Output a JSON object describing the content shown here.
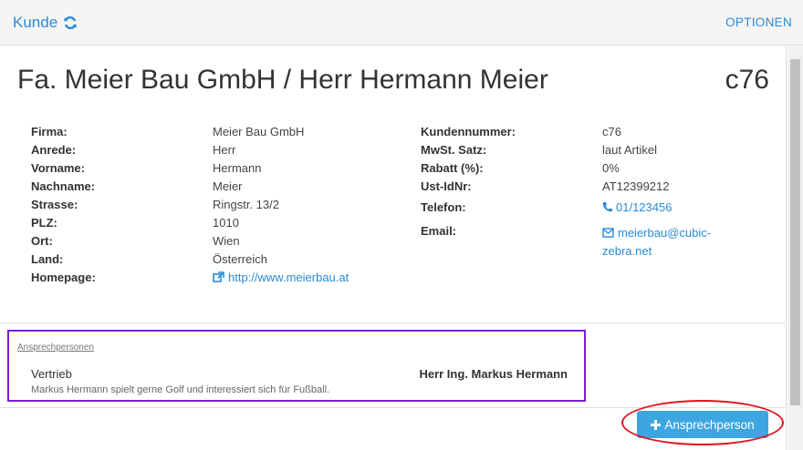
{
  "header": {
    "title": "Kunde",
    "options_label": "OPTIONEN"
  },
  "customer": {
    "display_name": "Fa. Meier Bau GmbH / Herr Hermann Meier",
    "code": "c76"
  },
  "left_fields": [
    {
      "label": "Firma:",
      "value": "Meier Bau GmbH"
    },
    {
      "label": "Anrede:",
      "value": "Herr"
    },
    {
      "label": "Vorname:",
      "value": "Hermann"
    },
    {
      "label": "Nachname:",
      "value": "Meier"
    },
    {
      "label": "Strasse:",
      "value": "Ringstr. 13/2"
    },
    {
      "label": "PLZ:",
      "value": "1010"
    },
    {
      "label": "Ort:",
      "value": "Wien"
    },
    {
      "label": "Land:",
      "value": "Österreich"
    },
    {
      "label": "Homepage:",
      "value": "http://www.meierbau.at"
    }
  ],
  "right_fields": [
    {
      "label": "Kundennummer:",
      "value": "c76"
    },
    {
      "label": "MwSt. Satz:",
      "value": "laut Artikel"
    },
    {
      "label": "Rabatt (%):",
      "value": "0%"
    },
    {
      "label": "Ust-IdNr:",
      "value": "AT12399212"
    },
    {
      "label": "Telefon:",
      "value": "01/123456"
    },
    {
      "label": "Email:",
      "value_line1": "meierbau@cubic-",
      "value_line2": "zebra.net"
    }
  ],
  "contacts": {
    "heading": "Ansprechpersonen",
    "items": [
      {
        "role": "Vertrieb",
        "name": "Herr Ing. Markus Hermann",
        "note": "Markus Hermann spielt gerne Golf und interessiert sich für Fußball."
      }
    ]
  },
  "add_contact_label": "Ansprechperson",
  "colors": {
    "accent": "#2a8bd6",
    "button": "#3da6e0",
    "highlight_box": "#7a1fd6",
    "highlight_ellipse": "#e0141f"
  },
  "icons": {
    "refresh": "refresh-icon",
    "external_link": "external-link-icon",
    "phone": "phone-icon",
    "email": "envelope-icon",
    "plus": "plus-icon"
  }
}
